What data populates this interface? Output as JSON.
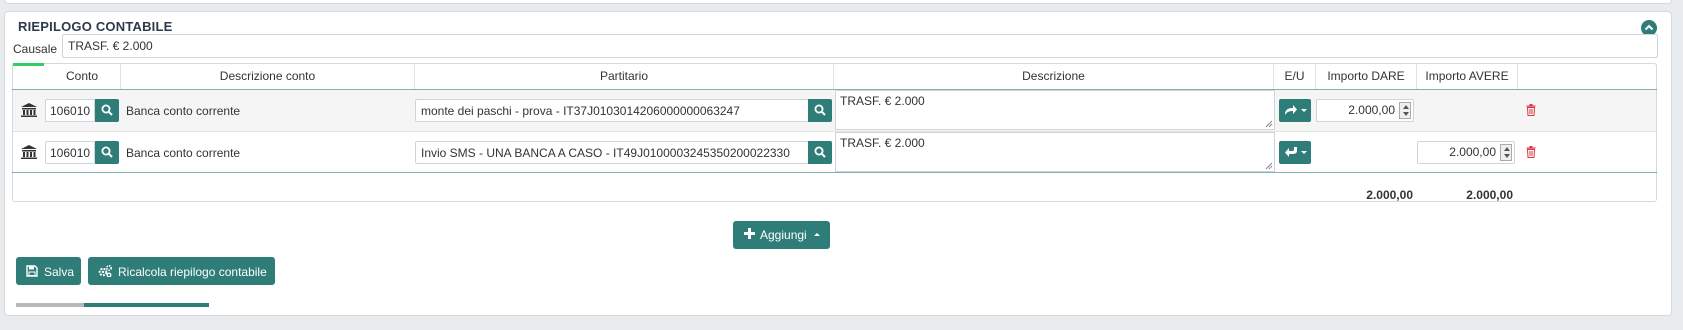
{
  "section": {
    "title": "RIEPILOGO CONTABILE",
    "collapse_icon": "chevron-up-icon"
  },
  "causale": {
    "label": "Causale",
    "value": "TRASF. € 2.000"
  },
  "table": {
    "headers": {
      "conto": "Conto",
      "descrizione_conto": "Descrizione conto",
      "partitario": "Partitario",
      "descrizione": "Descrizione",
      "eu": "E/U",
      "importo_dare": "Importo DARE",
      "importo_avere": "Importo AVERE"
    },
    "rows": [
      {
        "conto": "106010",
        "descrizione_conto": "Banca conto corrente",
        "partitario": "monte dei paschi - prova - IT37J0103014206000000063247",
        "descrizione": "TRASF. € 2.000",
        "eu_icon": "share-icon",
        "importo_dare": "2.000,00",
        "importo_avere": ""
      },
      {
        "conto": "106010",
        "descrizione_conto": "Banca conto corrente",
        "partitario": "Invio SMS - UNA BANCA A CASO - IT49J0100003245350200022330",
        "descrizione": "TRASF. € 2.000",
        "eu_icon": "reply-icon",
        "importo_dare": "",
        "importo_avere": "2.000,00"
      }
    ],
    "totals": {
      "dare": "2.000,00",
      "avere": "2.000,00"
    }
  },
  "actions": {
    "aggiungi": "Aggiungi",
    "salva": "Salva",
    "ricalcola": "Ricalcola riepilogo contabile"
  },
  "colors": {
    "accent": "#2f7d78",
    "danger": "#dc3545",
    "active_tab": "#33cc66"
  }
}
